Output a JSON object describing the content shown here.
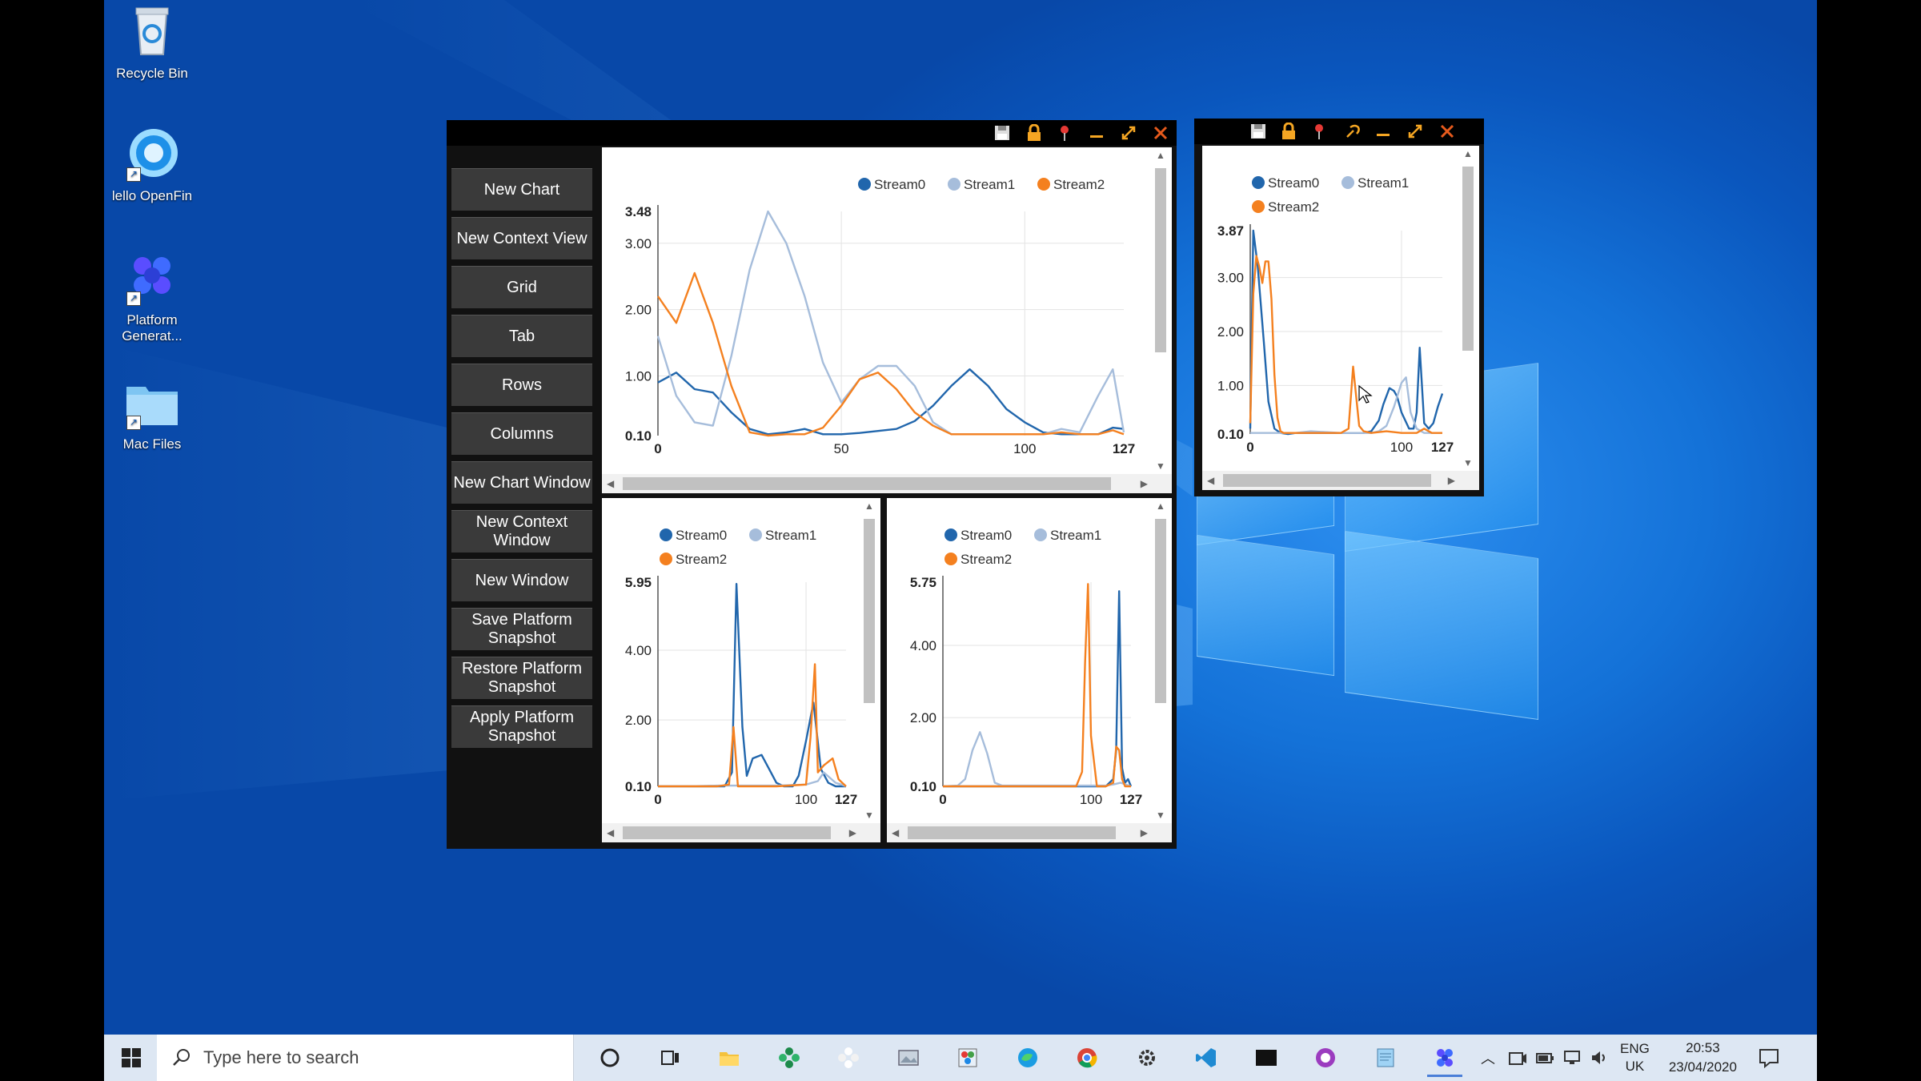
{
  "desktop": {
    "icons": [
      {
        "label": "Recycle Bin",
        "icon": "recycle-bin-icon"
      },
      {
        "label": "lello OpenFin",
        "icon": "openfin-icon"
      },
      {
        "label": "Platform Generat...",
        "icon": "platform-generator-icon"
      },
      {
        "label": "Mac Files",
        "icon": "folder-icon"
      }
    ]
  },
  "main_window": {
    "titlebar_icons": [
      "save-icon",
      "lock-icon",
      "pin-icon",
      "minimize-icon",
      "maximize-icon",
      "close-icon"
    ],
    "sidebar_buttons": [
      "New Chart",
      "New Context View",
      "Grid",
      "Tab",
      "Rows",
      "Columns",
      "New Chart Window",
      "New Context Window",
      "New Window",
      "Save Platform Snapshot",
      "Restore Platform Snapshot",
      "Apply Platform Snapshot"
    ]
  },
  "side_window": {
    "titlebar_icons": [
      "save-icon",
      "lock-icon",
      "pin-icon",
      "link-icon",
      "minimize-icon",
      "maximize-icon",
      "close-icon"
    ]
  },
  "colors": {
    "Stream0": "#2166ac",
    "Stream1": "#a6bddb",
    "Stream2": "#f4801f"
  },
  "chart_data": [
    {
      "id": "main-top-chart",
      "type": "line",
      "legend": [
        "Stream0",
        "Stream1",
        "Stream2"
      ],
      "y_tick_labels": [
        "3.48",
        "3.00",
        "2.00",
        "1.00",
        "0.10"
      ],
      "x_tick_labels": [
        "0",
        "50",
        "100",
        "127"
      ],
      "ylim": [
        0.1,
        3.48
      ],
      "xlim": [
        0,
        127
      ],
      "grid": true,
      "legend_position": "top-right",
      "series": [
        {
          "name": "Stream0",
          "x": [
            0,
            5,
            10,
            15,
            20,
            25,
            30,
            35,
            40,
            45,
            50,
            55,
            60,
            65,
            70,
            75,
            80,
            85,
            90,
            95,
            100,
            105,
            110,
            115,
            120,
            124,
            127
          ],
          "values": [
            0.9,
            1.05,
            0.8,
            0.75,
            0.45,
            0.2,
            0.12,
            0.15,
            0.2,
            0.12,
            0.12,
            0.14,
            0.17,
            0.2,
            0.32,
            0.55,
            0.85,
            1.1,
            0.85,
            0.5,
            0.3,
            0.15,
            0.12,
            0.12,
            0.12,
            0.22,
            0.2
          ]
        },
        {
          "name": "Stream1",
          "x": [
            0,
            5,
            10,
            15,
            20,
            25,
            30,
            35,
            40,
            45,
            50,
            55,
            60,
            65,
            70,
            75,
            80,
            85,
            90,
            95,
            100,
            105,
            110,
            115,
            120,
            124,
            127
          ],
          "values": [
            1.6,
            0.7,
            0.3,
            0.25,
            1.3,
            2.6,
            3.48,
            3.0,
            2.2,
            1.2,
            0.6,
            0.95,
            1.15,
            1.15,
            0.85,
            0.3,
            0.12,
            0.12,
            0.12,
            0.12,
            0.12,
            0.12,
            0.2,
            0.15,
            0.7,
            1.1,
            0.15
          ]
        },
        {
          "name": "Stream2",
          "x": [
            0,
            5,
            10,
            15,
            20,
            25,
            30,
            35,
            40,
            45,
            50,
            55,
            60,
            65,
            70,
            75,
            80,
            85,
            90,
            95,
            100,
            105,
            110,
            115,
            120,
            124,
            127
          ],
          "values": [
            2.2,
            1.8,
            2.55,
            1.8,
            0.85,
            0.15,
            0.1,
            0.12,
            0.12,
            0.22,
            0.55,
            0.95,
            1.05,
            0.8,
            0.45,
            0.25,
            0.12,
            0.12,
            0.12,
            0.12,
            0.12,
            0.12,
            0.15,
            0.12,
            0.12,
            0.18,
            0.12
          ]
        }
      ]
    },
    {
      "id": "main-bottom-left-chart",
      "type": "line",
      "legend": [
        "Stream0",
        "Stream1",
        "Stream2"
      ],
      "y_tick_labels": [
        "5.95",
        "4.00",
        "2.00",
        "0.10"
      ],
      "x_tick_labels": [
        "0",
        "100",
        "127"
      ],
      "ylim": [
        0.1,
        5.95
      ],
      "xlim": [
        0,
        127
      ],
      "grid": true,
      "legend_position": "top-left",
      "series": [
        {
          "name": "Stream0",
          "x": [
            0,
            40,
            45,
            50,
            53,
            57,
            60,
            64,
            70,
            75,
            80,
            85,
            88,
            91,
            95,
            100,
            105,
            110,
            115,
            120,
            127
          ],
          "values": [
            0.1,
            0.1,
            0.1,
            0.5,
            5.9,
            1.8,
            0.4,
            0.9,
            1.0,
            0.6,
            0.2,
            0.1,
            0.1,
            0.1,
            0.4,
            1.4,
            2.5,
            0.6,
            0.2,
            0.1,
            0.1
          ]
        },
        {
          "name": "Stream1",
          "x": [
            0,
            20,
            40,
            60,
            80,
            100,
            108,
            112,
            116,
            120,
            124,
            127
          ],
          "values": [
            0.1,
            0.1,
            0.12,
            0.12,
            0.12,
            0.15,
            0.25,
            0.5,
            0.35,
            0.2,
            0.15,
            0.1
          ]
        },
        {
          "name": "Stream2",
          "x": [
            0,
            40,
            48,
            51,
            54,
            60,
            80,
            100,
            103,
            106,
            108,
            112,
            118,
            122,
            127
          ],
          "values": [
            0.1,
            0.1,
            0.15,
            1.8,
            0.1,
            0.1,
            0.1,
            0.15,
            1.5,
            3.6,
            0.5,
            0.7,
            0.9,
            0.3,
            0.1
          ]
        }
      ]
    },
    {
      "id": "main-bottom-right-chart",
      "type": "line",
      "legend": [
        "Stream0",
        "Stream1",
        "Stream2"
      ],
      "y_tick_labels": [
        "5.75",
        "4.00",
        "2.00",
        "0.10"
      ],
      "x_tick_labels": [
        "0",
        "100",
        "127"
      ],
      "ylim": [
        0.1,
        5.75
      ],
      "xlim": [
        0,
        127
      ],
      "grid": true,
      "legend_position": "top-left",
      "series": [
        {
          "name": "Stream0",
          "x": [
            0,
            50,
            90,
            110,
            115,
            117,
            119,
            121,
            123,
            125,
            127
          ],
          "values": [
            0.1,
            0.1,
            0.1,
            0.1,
            0.3,
            1.1,
            5.5,
            0.6,
            0.2,
            0.3,
            0.1
          ]
        },
        {
          "name": "Stream1",
          "x": [
            0,
            10,
            15,
            20,
            25,
            30,
            35,
            40,
            60,
            80,
            100,
            110,
            115,
            120,
            127
          ],
          "values": [
            0.1,
            0.12,
            0.3,
            1.1,
            1.6,
            1.0,
            0.2,
            0.12,
            0.12,
            0.12,
            0.12,
            0.12,
            0.15,
            0.2,
            0.1
          ]
        },
        {
          "name": "Stream2",
          "x": [
            0,
            50,
            90,
            94,
            96,
            98,
            100,
            104,
            110,
            115,
            117,
            119,
            121,
            123,
            127
          ],
          "values": [
            0.1,
            0.1,
            0.1,
            0.5,
            3.5,
            5.7,
            1.5,
            0.1,
            0.1,
            0.2,
            1.2,
            1.1,
            0.3,
            0.1,
            0.1
          ]
        }
      ]
    },
    {
      "id": "side-chart",
      "type": "line",
      "legend": [
        "Stream0",
        "Stream1",
        "Stream2"
      ],
      "y_tick_labels": [
        "3.87",
        "3.00",
        "2.00",
        "1.00",
        "0.10"
      ],
      "x_tick_labels": [
        "0",
        "100",
        "127"
      ],
      "ylim": [
        0.1,
        3.87
      ],
      "xlim": [
        0,
        127
      ],
      "grid": true,
      "legend_position": "top-left",
      "series": [
        {
          "name": "Stream0",
          "x": [
            0,
            2,
            5,
            9,
            12,
            16,
            20,
            25,
            30,
            40,
            60,
            75,
            80,
            85,
            88,
            92,
            95,
            97,
            100,
            105,
            108,
            110,
            112,
            115,
            118,
            121,
            124,
            127
          ],
          "values": [
            0.2,
            3.87,
            3.2,
            1.8,
            0.7,
            0.2,
            0.12,
            0.1,
            0.12,
            0.12,
            0.12,
            0.12,
            0.15,
            0.35,
            0.65,
            0.95,
            0.9,
            0.8,
            0.5,
            0.2,
            0.2,
            0.5,
            1.7,
            0.3,
            0.2,
            0.3,
            0.6,
            0.85
          ]
        },
        {
          "name": "Stream1",
          "x": [
            0,
            5,
            10,
            20,
            30,
            40,
            60,
            75,
            80,
            85,
            90,
            95,
            100,
            103,
            106,
            110,
            115,
            120,
            127
          ],
          "values": [
            0.12,
            0.12,
            0.12,
            0.12,
            0.12,
            0.15,
            0.12,
            0.12,
            0.12,
            0.15,
            0.25,
            0.6,
            1.05,
            1.15,
            0.5,
            0.2,
            0.12,
            0.12,
            0.12
          ]
        },
        {
          "name": "Stream2",
          "x": [
            0,
            2,
            4,
            6,
            8,
            10,
            12,
            14,
            16,
            18,
            20,
            22,
            25,
            30,
            40,
            50,
            60,
            65,
            68,
            72,
            75,
            80,
            90,
            100,
            110,
            115,
            120,
            127
          ],
          "values": [
            0.3,
            2.7,
            3.4,
            3.2,
            2.9,
            3.3,
            3.3,
            2.6,
            1.2,
            0.4,
            0.15,
            0.12,
            0.12,
            0.12,
            0.12,
            0.12,
            0.12,
            0.2,
            1.35,
            0.25,
            0.15,
            0.12,
            0.15,
            0.12,
            0.12,
            0.2,
            0.12,
            0.12
          ]
        }
      ]
    }
  ],
  "taskbar": {
    "search_placeholder": "Type here to search",
    "apps": [
      "cortana-icon",
      "task-view-icon",
      "file-explorer-icon",
      "openfin-green-icon",
      "openfin-white-icon",
      "photos-icon",
      "paint-icon",
      "edge-icon",
      "chrome-icon",
      "settings-icon",
      "vscode-icon",
      "terminal-icon",
      "github-icon",
      "notepad-icon",
      "platform-generator-icon"
    ],
    "language": "ENG",
    "region": "UK",
    "time": "20:53",
    "date": "23/04/2020"
  }
}
